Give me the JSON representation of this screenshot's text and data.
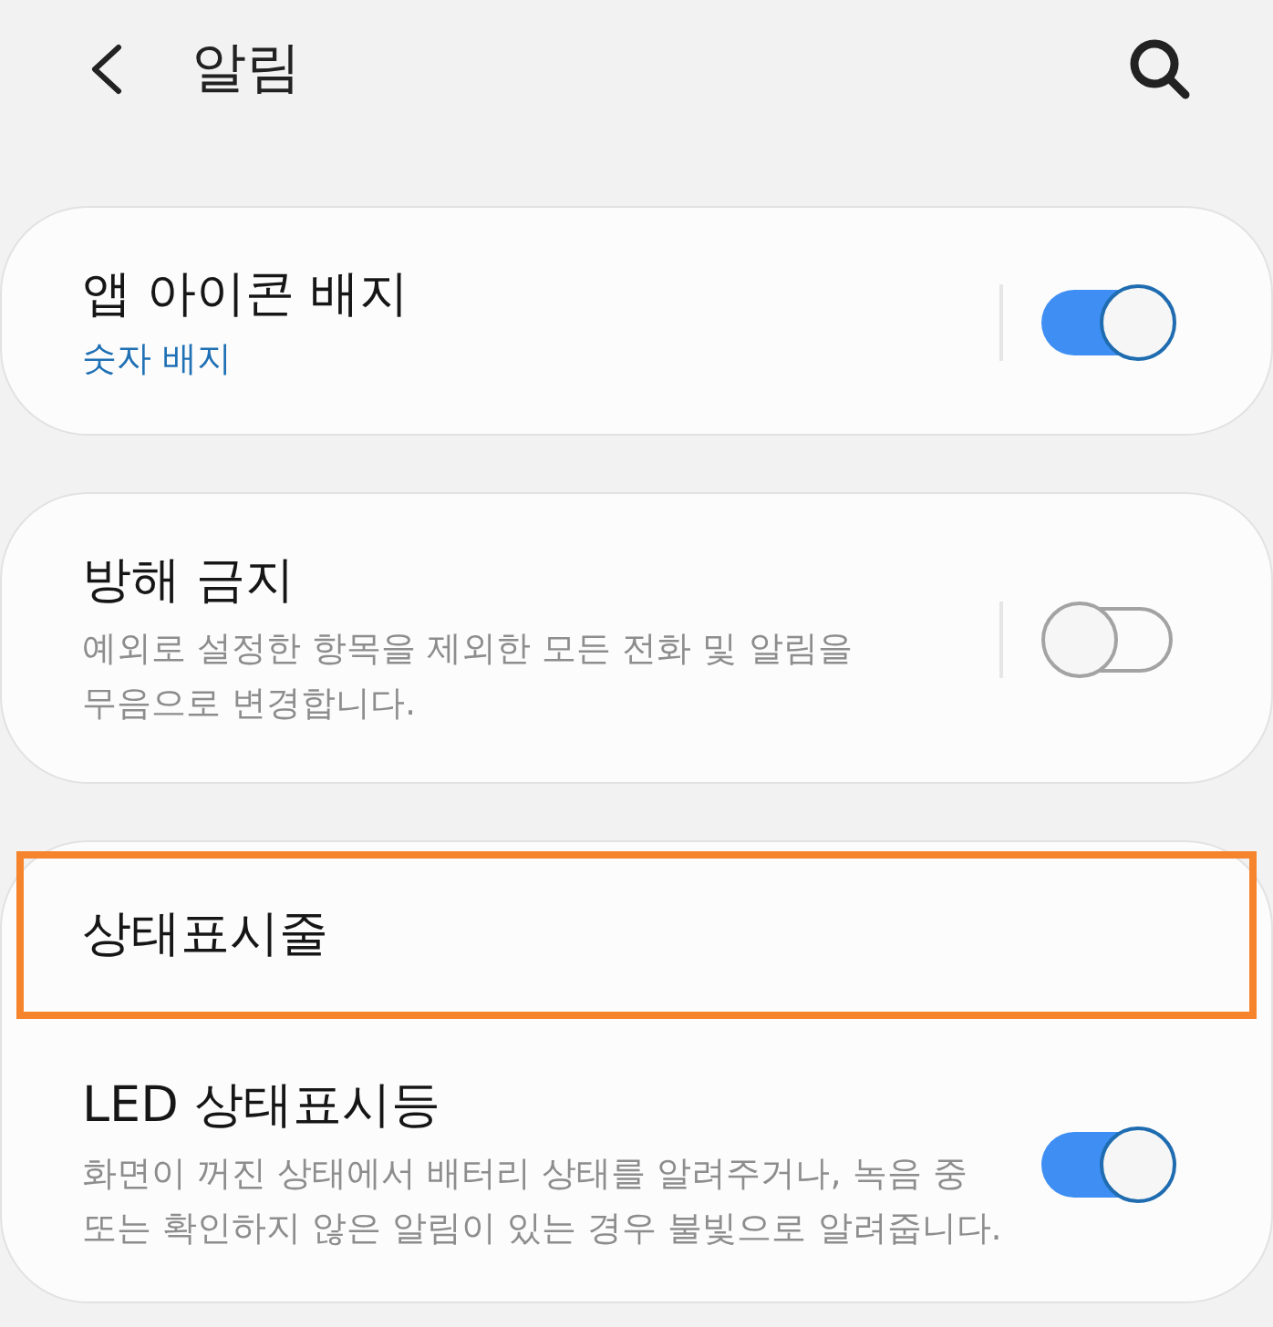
{
  "header": {
    "title": "알림"
  },
  "cards": [
    {
      "items": [
        {
          "kind": "toggle",
          "title": "앱 아이콘 배지",
          "value": "숫자 배지",
          "on": true,
          "split": true,
          "highlighted": false
        }
      ]
    },
    {
      "items": [
        {
          "kind": "toggle",
          "title": "방해 금지",
          "description": "예외로 설정한 항목을 제외한 모든 전화 및 알림을 무음으로 변경합니다.",
          "on": false,
          "split": true,
          "highlighted": false
        }
      ]
    },
    {
      "items": [
        {
          "kind": "link",
          "title": "상태표시줄",
          "highlighted": true
        },
        {
          "kind": "toggle",
          "title": "LED 상태표시등",
          "description": "화면이 꺼진 상태에서 배터리 상태를 알려주거나, 녹음 중 또는 확인하지 않은 알림이 있는 경우 불빛으로 알려줍니다.",
          "on": true,
          "split": false,
          "highlighted": false
        }
      ]
    }
  ]
}
